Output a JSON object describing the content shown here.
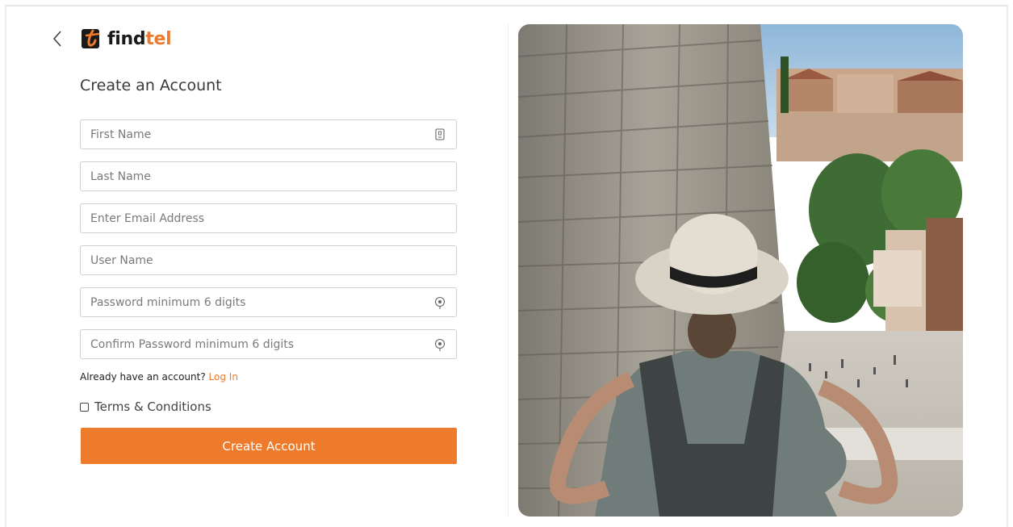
{
  "header": {
    "logo_part1": "find",
    "logo_part2": "tel"
  },
  "form": {
    "title": "Create an Account",
    "fields": [
      {
        "placeholder": "First Name",
        "icon": "contact-card-icon"
      },
      {
        "placeholder": "Last Name"
      },
      {
        "placeholder": "Enter Email Address"
      },
      {
        "placeholder": "User Name"
      },
      {
        "placeholder": "Password minimum 6 digits",
        "icon": "eye-icon"
      },
      {
        "placeholder": "Confirm Password minimum 6 digits",
        "icon": "eye-icon"
      }
    ],
    "have_account_text": "Already have an account?",
    "login_link": "Log In",
    "terms_label": "Terms & Conditions",
    "submit_label": "Create Account"
  },
  "colors": {
    "accent": "#ee7a2b",
    "border": "#cfcfcf"
  }
}
